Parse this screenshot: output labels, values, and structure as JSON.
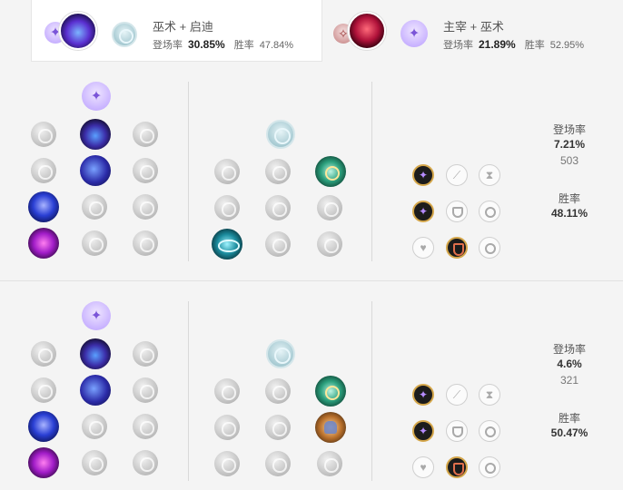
{
  "builds_tabs": [
    {
      "primary": "巫术",
      "secondary": "启迪",
      "joiner": " + ",
      "pick_label": "登场率",
      "pick_rate": "30.85%",
      "win_label": "胜率",
      "win_rate": "47.84%",
      "active": true
    },
    {
      "primary": "主宰",
      "secondary": "巫术",
      "joiner": " + ",
      "pick_label": "登场率",
      "pick_rate": "21.89%",
      "win_label": "胜率",
      "win_rate": "52.95%",
      "active": false
    }
  ],
  "rune_pages": [
    {
      "pick_label": "登场率",
      "pick_rate": "7.21%",
      "games": "503",
      "win_label": "胜率",
      "win_rate": "48.11%",
      "primary_tree": "sorcery-icon",
      "secondary_tree": "inspiration-icon",
      "selected": [
        "arcane-comet",
        "manaflow-band",
        "transcendence",
        "scorch",
        "cosmic-insight",
        "time-warp-tonic",
        "adaptive-force",
        "adaptive-force",
        "armor"
      ]
    },
    {
      "pick_label": "登场率",
      "pick_rate": "4.6%",
      "games": "321",
      "win_label": "胜率",
      "win_rate": "50.47%",
      "primary_tree": "sorcery-icon",
      "secondary_tree": "inspiration-icon",
      "selected": [
        "arcane-comet",
        "manaflow-band",
        "transcendence",
        "scorch",
        "cosmic-insight",
        "magical-footwear",
        "adaptive-force",
        "adaptive-force",
        "armor"
      ]
    }
  ]
}
